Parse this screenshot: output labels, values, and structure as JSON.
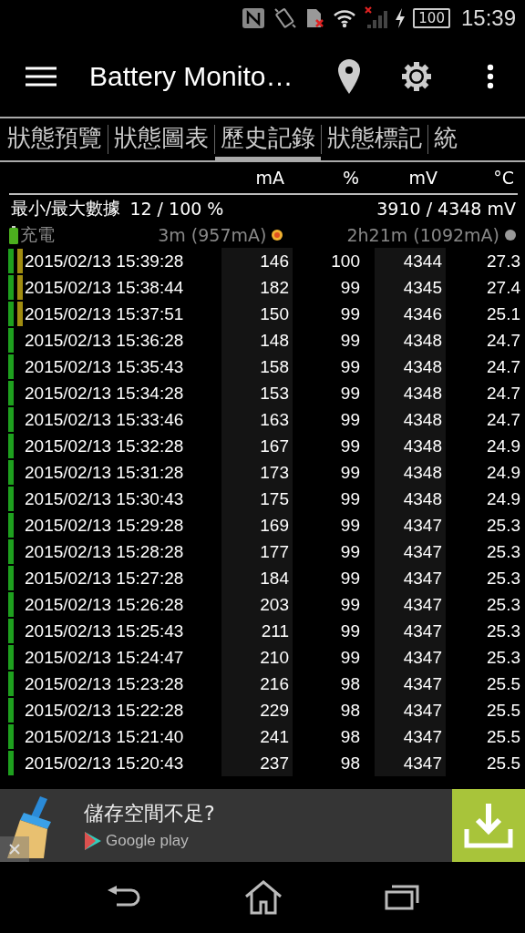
{
  "status_bar": {
    "battery": "100",
    "time": "15:39"
  },
  "app_bar": {
    "title": "Battery Monito…"
  },
  "tabs": [
    {
      "label": "狀態預覽",
      "selected": false
    },
    {
      "label": "狀態圖表",
      "selected": false
    },
    {
      "label": "歷史記錄",
      "selected": true
    },
    {
      "label": "狀態標記",
      "selected": false
    },
    {
      "label": "統",
      "selected": false
    }
  ],
  "table": {
    "columns": [
      "mA",
      "%",
      "mV",
      "°C"
    ],
    "summary": {
      "label": "最小/最大數據",
      "percent": "12 / 100 %",
      "voltage": "3910 / 4348 mV"
    },
    "charge": {
      "label": "充電",
      "elapsed": "3m (957mA)",
      "remaining": "2h21m (1092mA)"
    },
    "rows": [
      {
        "time": "2015/02/13 15:39:28",
        "ma": "146",
        "pct": "100",
        "mv": "4344",
        "temp": "27.3",
        "flagged": true
      },
      {
        "time": "2015/02/13 15:38:44",
        "ma": "182",
        "pct": "99",
        "mv": "4345",
        "temp": "27.4",
        "flagged": true
      },
      {
        "time": "2015/02/13 15:37:51",
        "ma": "150",
        "pct": "99",
        "mv": "4346",
        "temp": "25.1",
        "flagged": true
      },
      {
        "time": "2015/02/13 15:36:28",
        "ma": "148",
        "pct": "99",
        "mv": "4348",
        "temp": "24.7",
        "flagged": false
      },
      {
        "time": "2015/02/13 15:35:43",
        "ma": "158",
        "pct": "99",
        "mv": "4348",
        "temp": "24.7",
        "flagged": false
      },
      {
        "time": "2015/02/13 15:34:28",
        "ma": "153",
        "pct": "99",
        "mv": "4348",
        "temp": "24.7",
        "flagged": false
      },
      {
        "time": "2015/02/13 15:33:46",
        "ma": "163",
        "pct": "99",
        "mv": "4348",
        "temp": "24.7",
        "flagged": false
      },
      {
        "time": "2015/02/13 15:32:28",
        "ma": "167",
        "pct": "99",
        "mv": "4348",
        "temp": "24.9",
        "flagged": false
      },
      {
        "time": "2015/02/13 15:31:28",
        "ma": "173",
        "pct": "99",
        "mv": "4348",
        "temp": "24.9",
        "flagged": false
      },
      {
        "time": "2015/02/13 15:30:43",
        "ma": "175",
        "pct": "99",
        "mv": "4348",
        "temp": "24.9",
        "flagged": false
      },
      {
        "time": "2015/02/13 15:29:28",
        "ma": "169",
        "pct": "99",
        "mv": "4347",
        "temp": "25.3",
        "flagged": false
      },
      {
        "time": "2015/02/13 15:28:28",
        "ma": "177",
        "pct": "99",
        "mv": "4347",
        "temp": "25.3",
        "flagged": false
      },
      {
        "time": "2015/02/13 15:27:28",
        "ma": "184",
        "pct": "99",
        "mv": "4347",
        "temp": "25.3",
        "flagged": false
      },
      {
        "time": "2015/02/13 15:26:28",
        "ma": "203",
        "pct": "99",
        "mv": "4347",
        "temp": "25.3",
        "flagged": false
      },
      {
        "time": "2015/02/13 15:25:43",
        "ma": "211",
        "pct": "99",
        "mv": "4347",
        "temp": "25.3",
        "flagged": false
      },
      {
        "time": "2015/02/13 15:24:47",
        "ma": "210",
        "pct": "99",
        "mv": "4347",
        "temp": "25.3",
        "flagged": false
      },
      {
        "time": "2015/02/13 15:23:28",
        "ma": "216",
        "pct": "98",
        "mv": "4347",
        "temp": "25.5",
        "flagged": false
      },
      {
        "time": "2015/02/13 15:22:28",
        "ma": "229",
        "pct": "98",
        "mv": "4347",
        "temp": "25.5",
        "flagged": false
      },
      {
        "time": "2015/02/13 15:21:40",
        "ma": "241",
        "pct": "98",
        "mv": "4347",
        "temp": "25.5",
        "flagged": false
      },
      {
        "time": "2015/02/13 15:20:43",
        "ma": "237",
        "pct": "98",
        "mv": "4347",
        "temp": "25.5",
        "flagged": false
      }
    ]
  },
  "ad": {
    "headline": "儲存空間不足?",
    "store": "Google play"
  }
}
